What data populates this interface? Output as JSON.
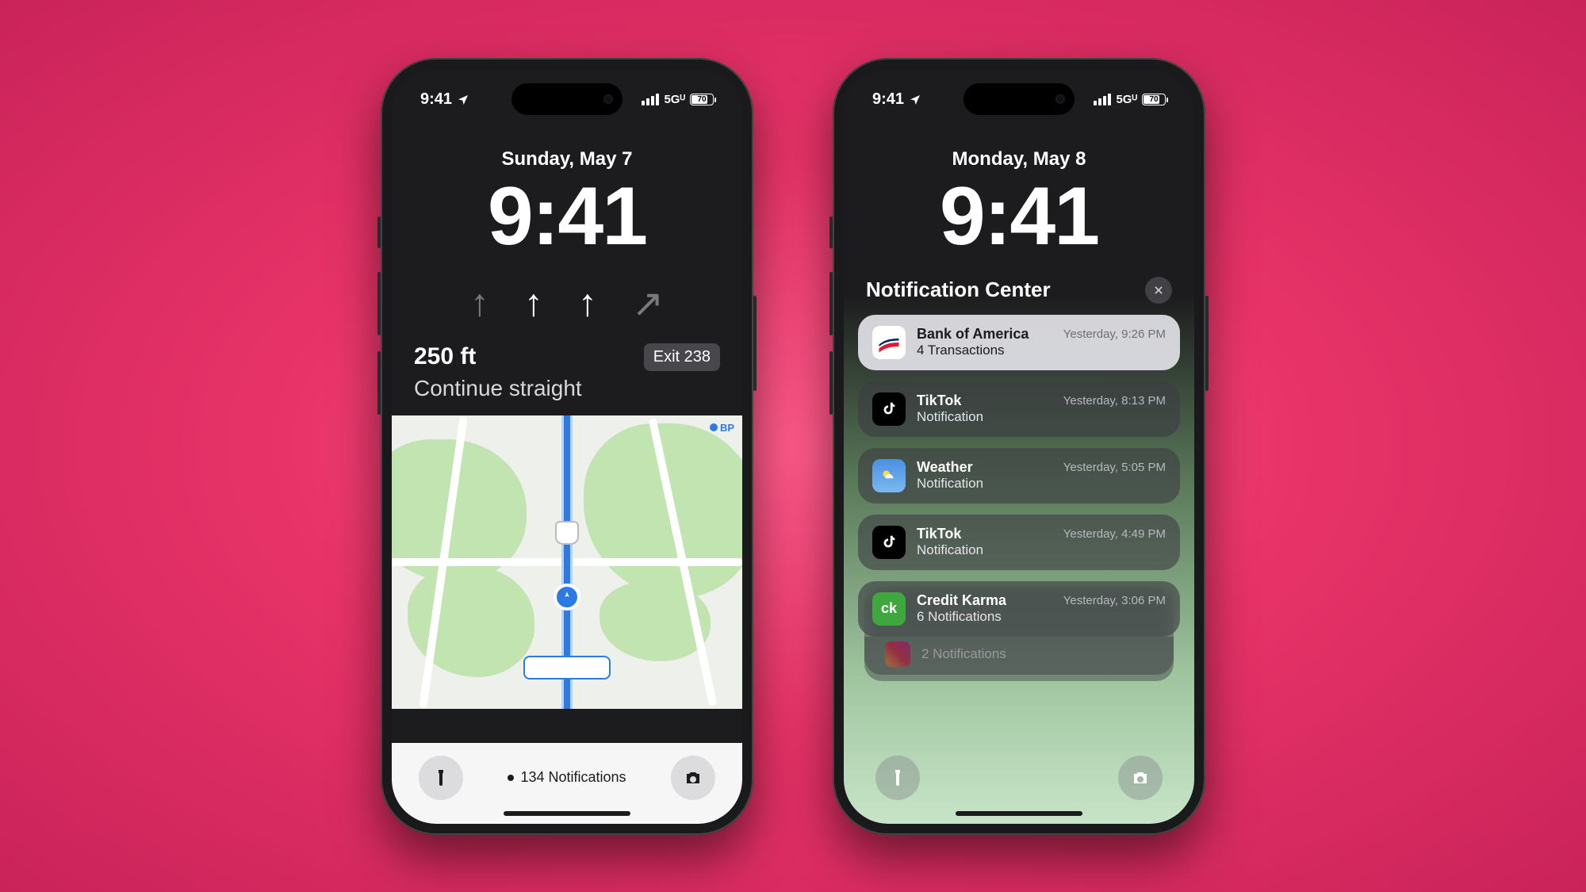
{
  "status": {
    "time": "9:41",
    "network": "5Gᵁ",
    "battery": "70"
  },
  "phone1": {
    "date": "Sunday, May 7",
    "time": "9:41",
    "nav": {
      "distance": "250 ft",
      "exit": "Exit 238",
      "instruction": "Continue straight"
    },
    "mapPin": "BP",
    "notifCount": "134 Notifications"
  },
  "phone2": {
    "date": "Monday, May 8",
    "time": "9:41",
    "ncTitle": "Notification Center",
    "notifications": [
      {
        "app": "Bank of America",
        "sub": "4 Transactions",
        "time": "Yesterday, 9:26 PM",
        "icon": "bofa"
      },
      {
        "app": "TikTok",
        "sub": "Notification",
        "time": "Yesterday, 8:13 PM",
        "icon": "tiktok"
      },
      {
        "app": "Weather",
        "sub": "Notification",
        "time": "Yesterday, 5:05 PM",
        "icon": "weather"
      },
      {
        "app": "TikTok",
        "sub": "Notification",
        "time": "Yesterday, 4:49 PM",
        "icon": "tiktok"
      },
      {
        "app": "Credit Karma",
        "sub": "6 Notifications",
        "time": "Yesterday, 3:06 PM",
        "icon": "ck"
      }
    ],
    "peek": {
      "sub": "2 Notifications",
      "icon": "ig"
    }
  }
}
